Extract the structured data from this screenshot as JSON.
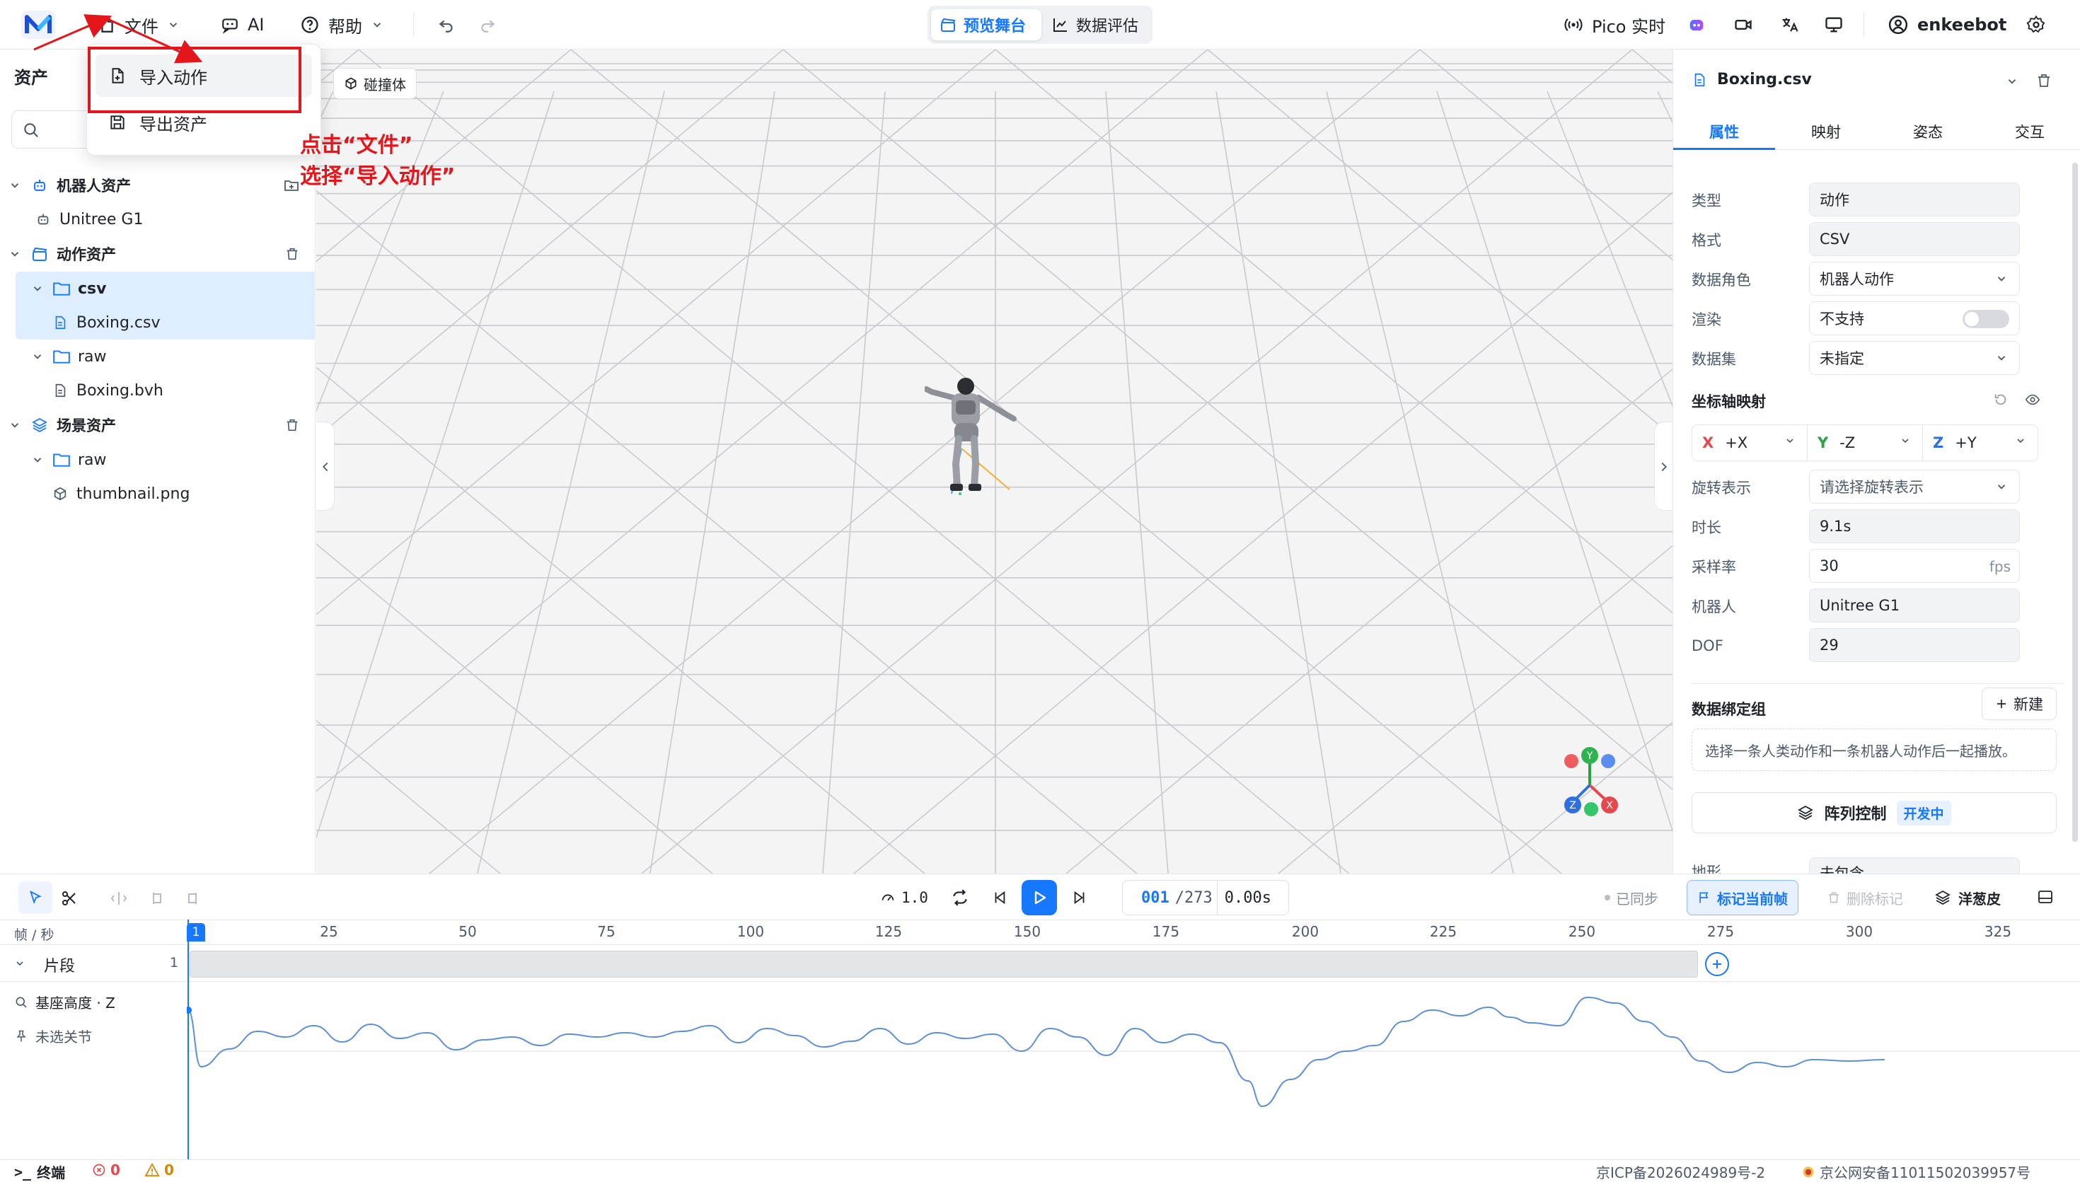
{
  "topbar": {
    "file_label": "文件",
    "ai_label": "AI",
    "help_label": "帮助",
    "tab_preview": "预览舞台",
    "tab_eval": "数据评估",
    "pico_label": "Pico 实时",
    "user_name": "enkeebot"
  },
  "file_menu": {
    "import_label": "导入动作",
    "export_label": "导出资产"
  },
  "annotation": {
    "line1": "点击“文件”",
    "line2": "选择“导入动作”"
  },
  "left_panel": {
    "title": "资产",
    "robot_group": "机器人资产",
    "robot_item": "Unitree G1",
    "motion_group": "动作资产",
    "csv_folder": "csv",
    "csv_file": "Boxing.csv",
    "raw_folder": "raw",
    "bvh_file": "Boxing.bvh",
    "scene_group": "场景资产",
    "scene_raw_folder": "raw",
    "scene_file": "thumbnail.png"
  },
  "viewport": {
    "collider_button": "碰撞体",
    "gizmo": {
      "x": "X",
      "y": "Y",
      "z": "Z"
    }
  },
  "right_panel": {
    "file_name": "Boxing.csv",
    "tabs": [
      "属性",
      "映射",
      "姿态",
      "交互"
    ],
    "props": {
      "type_label": "类型",
      "type_value": "动作",
      "format_label": "格式",
      "format_value": "CSV",
      "role_label": "数据角色",
      "role_value": "机器人动作",
      "render_label": "渲染",
      "render_value": "不支持",
      "dataset_label": "数据集",
      "dataset_value": "未指定",
      "axis_title": "坐标轴映射",
      "axis_x_label": "X",
      "axis_x_value": "+X",
      "axis_y_label": "Y",
      "axis_y_value": "-Z",
      "axis_z_label": "Z",
      "axis_z_value": "+Y",
      "rotation_label": "旋转表示",
      "rotation_placeholder": "请选择旋转表示",
      "duration_label": "时长",
      "duration_value": "9.1s",
      "fps_label": "采样率",
      "fps_value": "30",
      "fps_unit": "fps",
      "robot_label": "机器人",
      "robot_value": "Unitree G1",
      "dof_label": "DOF",
      "dof_value": "29"
    },
    "binding_title": "数据绑定组",
    "new_button": "新建",
    "binding_hint": "选择一条人类动作和一条机器人动作后一起播放。",
    "array_button": "阵列控制",
    "dev_badge": "开发中",
    "terrain_label": "地形",
    "terrain_value": "未包含"
  },
  "timeline": {
    "speed": "1.0",
    "frame_current": "001",
    "frame_total": "/273",
    "time_value": "0.00s",
    "synced": "已同步",
    "mark_button": "标记当前帧",
    "delete_mark": "删除标记",
    "onion_skin": "洋葱皮",
    "unit_label": "帧 / 秒",
    "ticks": [
      "25",
      "50",
      "75",
      "100",
      "125",
      "150",
      "175",
      "200",
      "225",
      "250",
      "275",
      "300",
      "325"
    ],
    "start_marker": "1",
    "clip_label": "片段",
    "clip_count": "1",
    "base_height_label": "基座高度 · Z",
    "no_joint_label": "未选关节"
  },
  "statusbar": {
    "terminal": "终端",
    "errors": "0",
    "warnings": "0",
    "icp": "京ICP备2026024989号-2",
    "police": "京公网安备11011502039957号"
  },
  "colors": {
    "accent": "#1677ff",
    "annotation_red": "#e5161b",
    "active_bg": "#dfeeff"
  }
}
